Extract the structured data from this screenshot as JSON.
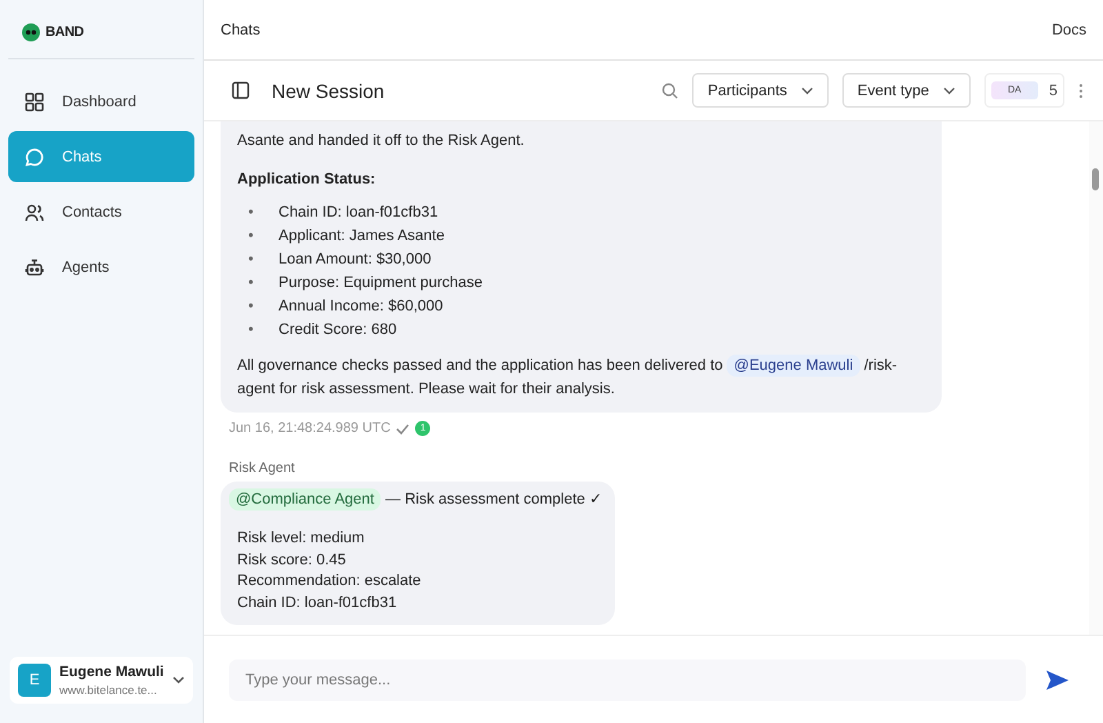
{
  "sidebar": {
    "brand": "BAND",
    "items": [
      {
        "label": "Dashboard",
        "selected": false
      },
      {
        "label": "Chats",
        "selected": true
      },
      {
        "label": "Contacts",
        "selected": false
      },
      {
        "label": "Agents",
        "selected": false
      }
    ],
    "user": {
      "initial": "E",
      "name": "Eugene Mawuli",
      "site": "www.bitelance.te..."
    }
  },
  "header": {
    "title": "Chats",
    "link": "Docs"
  },
  "session": {
    "title": "New Session",
    "filters": [
      "Participants",
      "Event type"
    ],
    "avatar_label": "DA",
    "participant_count": "5"
  },
  "messages": [
    {
      "kind": "summary",
      "lead": "Asante and handed it off to the Risk Agent.",
      "heading": "Application Status:",
      "bullet_marker": "•",
      "bullets": [
        "Chain ID: loan-f01cfb31",
        "Applicant: James Asante",
        "Loan Amount: $30,000",
        "Purpose: Equipment purchase",
        "Annual Income: $60,000",
        "Credit Score: 680"
      ],
      "closing_before": "All governance checks passed and the application has been delivered to",
      "mention": "@Eugene Mawuli",
      "closing_after": "/risk-agent for risk assessment. Please wait for their analysis.",
      "timestamp": "Jun 16, 21:48:24.989 UTC",
      "read_count": "1"
    },
    {
      "kind": "assessment",
      "sender": "Risk Agent",
      "mention": "@Compliance Agent",
      "headline": "— Risk assessment complete ✓",
      "lines": [
        "Risk level: medium",
        "Risk score: 0.45",
        "Recommendation: escalate",
        "Chain ID: loan-f01cfb31"
      ]
    }
  ],
  "composer": {
    "placeholder": "Type your message..."
  }
}
